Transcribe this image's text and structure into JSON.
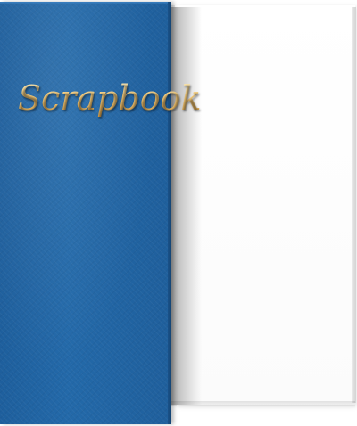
{
  "book": {
    "cover_title": "Scrapbook"
  },
  "colors": {
    "cover": "#2369a9",
    "title": "#f5cd7e",
    "page": "#ffffff"
  }
}
